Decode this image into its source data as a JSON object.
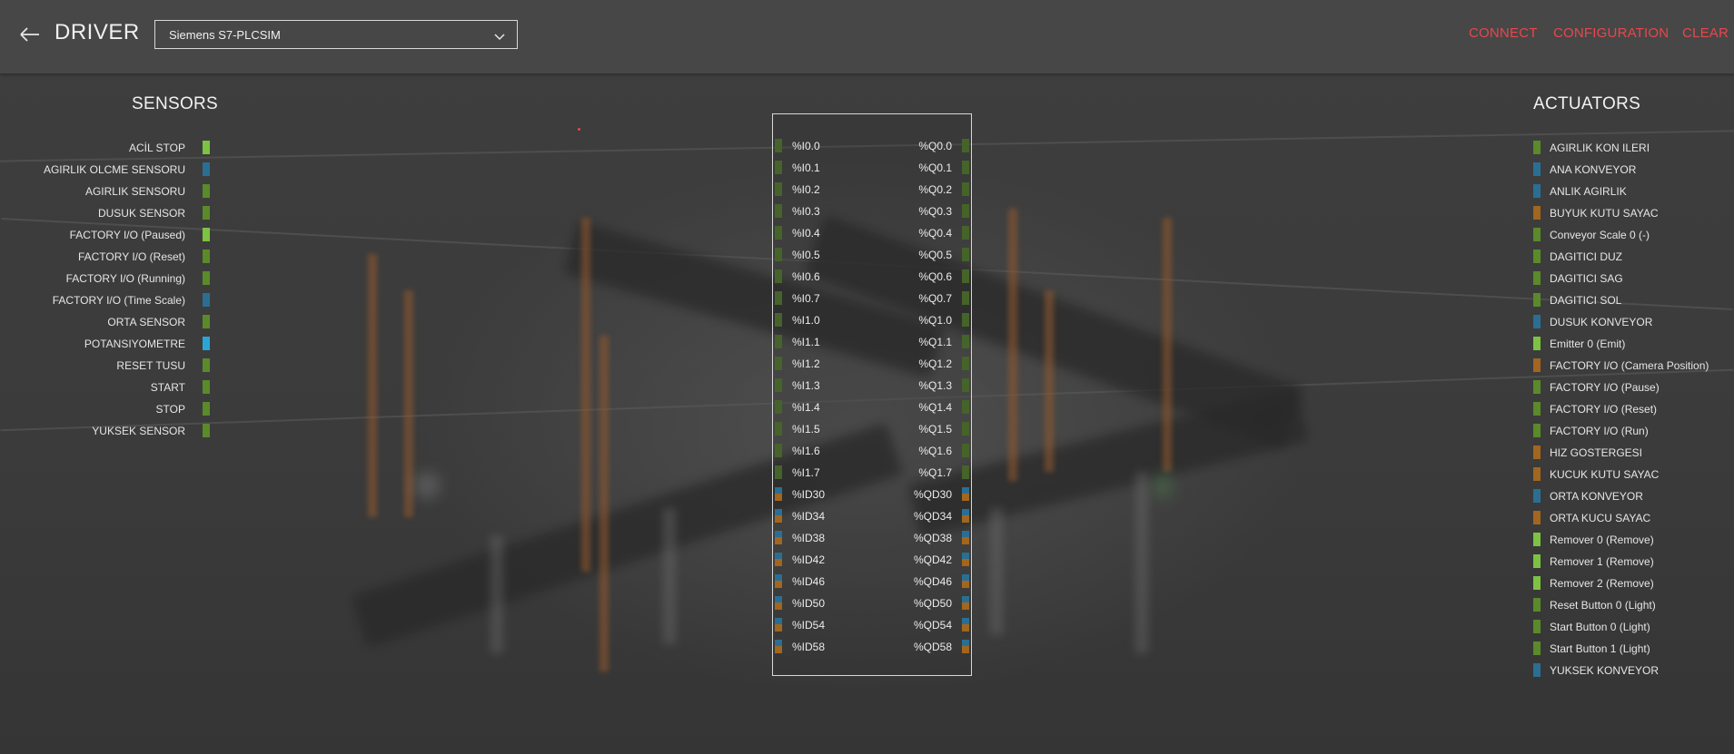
{
  "header": {
    "title": "DRIVER",
    "driver_selected": "Siemens S7-PLCSIM",
    "actions": [
      "CONNECT",
      "CONFIGURATION",
      "CLEAR"
    ]
  },
  "colors": {
    "accent": "#e8474c",
    "bool_green": "#5a8a2a",
    "bool_green_bright": "#7dc242",
    "int_blue": "#2a6f93",
    "int_blue_bright": "#2aa5d8",
    "float_orange": "#a2661e",
    "port_green_dark": "#46632a"
  },
  "sensors": {
    "title": "SENSORS",
    "items": [
      {
        "label": "ACİL STOP",
        "type": "bool_bright"
      },
      {
        "label": "AGIRLIK OLCME SENSORU",
        "type": "int"
      },
      {
        "label": "AGIRLIK SENSORU",
        "type": "bool"
      },
      {
        "label": "DUSUK SENSOR",
        "type": "bool"
      },
      {
        "label": "FACTORY I/O (Paused)",
        "type": "bool_bright"
      },
      {
        "label": "FACTORY I/O (Reset)",
        "type": "bool"
      },
      {
        "label": "FACTORY I/O (Running)",
        "type": "bool"
      },
      {
        "label": "FACTORY I/O (Time Scale)",
        "type": "int"
      },
      {
        "label": "ORTA SENSOR",
        "type": "bool"
      },
      {
        "label": "POTANSIYOMETRE",
        "type": "int_bright"
      },
      {
        "label": "RESET TUSU",
        "type": "bool"
      },
      {
        "label": "START",
        "type": "bool"
      },
      {
        "label": "STOP",
        "type": "bool"
      },
      {
        "label": "YUKSEK SENSOR",
        "type": "bool"
      }
    ]
  },
  "actuators": {
    "title": "ACTUATORS",
    "items": [
      {
        "label": "AGIRLIK KON ILERI",
        "type": "bool"
      },
      {
        "label": "ANA KONVEYOR",
        "type": "int"
      },
      {
        "label": "ANLIK AGIRLIK",
        "type": "int"
      },
      {
        "label": "BUYUK KUTU SAYAC",
        "type": "float"
      },
      {
        "label": "Conveyor Scale 0 (-)",
        "type": "bool"
      },
      {
        "label": "DAGITICI DUZ",
        "type": "bool"
      },
      {
        "label": "DAGITICI SAG",
        "type": "bool"
      },
      {
        "label": "DAGITICI SOL",
        "type": "bool"
      },
      {
        "label": "DUSUK KONVEYOR",
        "type": "int"
      },
      {
        "label": "Emitter 0 (Emit)",
        "type": "bool_bright"
      },
      {
        "label": "FACTORY I/O (Camera Position)",
        "type": "float"
      },
      {
        "label": "FACTORY I/O (Pause)",
        "type": "bool"
      },
      {
        "label": "FACTORY I/O (Reset)",
        "type": "bool"
      },
      {
        "label": "FACTORY I/O (Run)",
        "type": "bool"
      },
      {
        "label": "HIZ GOSTERGESI",
        "type": "float"
      },
      {
        "label": "KUCUK KUTU SAYAC",
        "type": "float"
      },
      {
        "label": "ORTA KONVEYOR",
        "type": "int"
      },
      {
        "label": "ORTA KUCU SAYAC",
        "type": "float"
      },
      {
        "label": "Remover 0 (Remove)",
        "type": "bool_bright"
      },
      {
        "label": "Remover 1 (Remove)",
        "type": "bool_bright"
      },
      {
        "label": "Remover 2 (Remove)",
        "type": "bool_bright"
      },
      {
        "label": "Reset Button 0 (Light)",
        "type": "bool"
      },
      {
        "label": "Start Button 0 (Light)",
        "type": "bool"
      },
      {
        "label": "Start Button 1 (Light)",
        "type": "bool"
      },
      {
        "label": "YUKSEK KONVEYOR",
        "type": "int"
      }
    ]
  },
  "addresses": {
    "inputs": [
      "%I0.0",
      "%I0.1",
      "%I0.2",
      "%I0.3",
      "%I0.4",
      "%I0.5",
      "%I0.6",
      "%I0.7",
      "%I1.0",
      "%I1.1",
      "%I1.2",
      "%I1.3",
      "%I1.4",
      "%I1.5",
      "%I1.6",
      "%I1.7",
      "%ID30",
      "%ID34",
      "%ID38",
      "%ID42",
      "%ID46",
      "%ID50",
      "%ID54",
      "%ID58"
    ],
    "outputs": [
      "%Q0.0",
      "%Q0.1",
      "%Q0.2",
      "%Q0.3",
      "%Q0.4",
      "%Q0.5",
      "%Q0.6",
      "%Q0.7",
      "%Q1.0",
      "%Q1.1",
      "%Q1.2",
      "%Q1.3",
      "%Q1.4",
      "%Q1.5",
      "%Q1.6",
      "%Q1.7",
      "%QD30",
      "%QD34",
      "%QD38",
      "%QD42",
      "%QD46",
      "%QD50",
      "%QD54",
      "%QD58"
    ]
  }
}
